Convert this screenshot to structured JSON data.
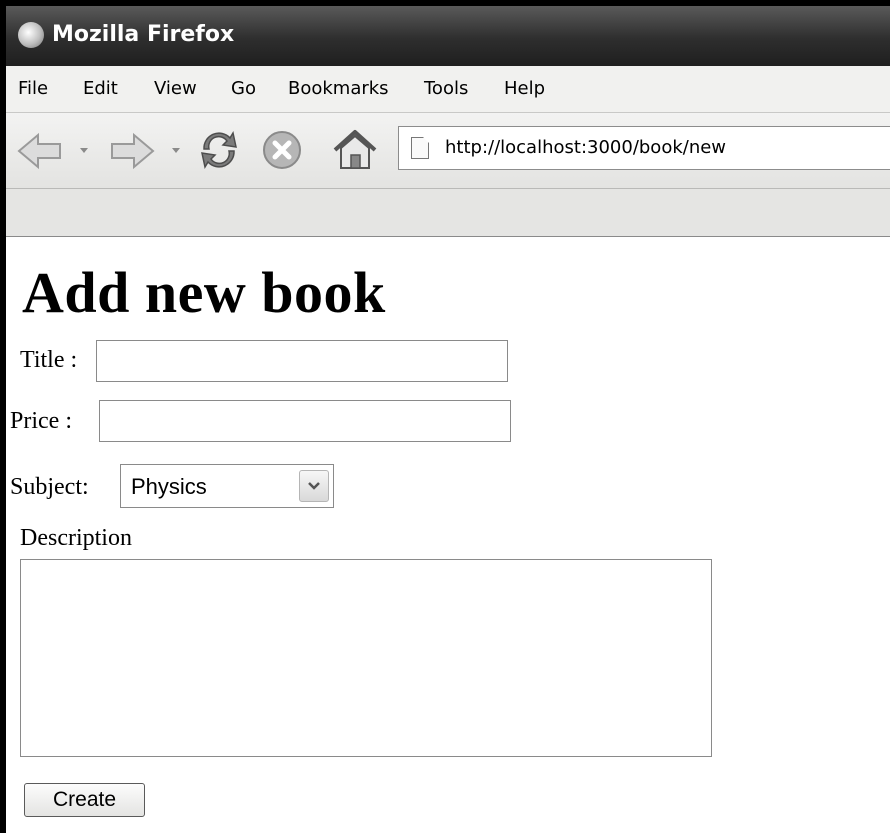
{
  "window": {
    "title": "Mozilla Firefox",
    "logo_icon": "firefox-logo-icon"
  },
  "menu": {
    "items": [
      {
        "label": "File"
      },
      {
        "label": "Edit"
      },
      {
        "label": "View"
      },
      {
        "label": "Go"
      },
      {
        "label": "Bookmarks"
      },
      {
        "label": "Tools"
      },
      {
        "label": "Help"
      }
    ]
  },
  "toolbar": {
    "url": "http://localhost:3000/book/new",
    "icons": [
      "back-arrow-icon",
      "forward-arrow-icon",
      "reload-icon",
      "stop-icon",
      "home-icon",
      "page-icon"
    ]
  },
  "page": {
    "heading": "Add new book",
    "title_label": "Title :",
    "title_value": "",
    "price_label": "Price :",
    "price_value": "",
    "subject_label": "Subject:",
    "subject_value": "Physics",
    "description_label": "Description",
    "description_value": "",
    "create_label": "Create"
  }
}
